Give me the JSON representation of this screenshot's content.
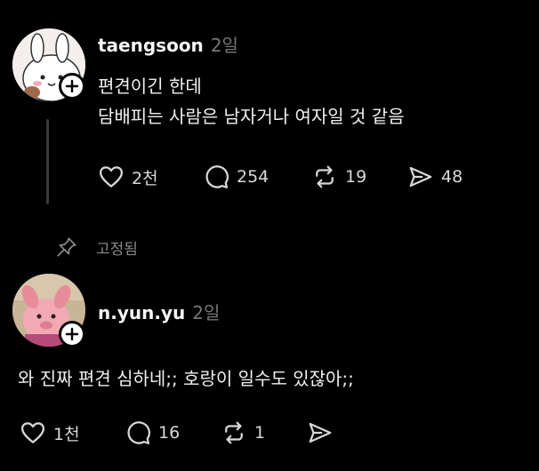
{
  "pinned_label": "고정됨",
  "posts": [
    {
      "username": "taengsoon",
      "time": "2일",
      "lines": [
        "편견이긴 한데",
        "담배피는 사람은 남자거나 여자일 것 같음"
      ],
      "likes": "2천",
      "comments": "254",
      "reposts": "19",
      "shares": "48"
    },
    {
      "username": "n.yun.yu",
      "time": "2일",
      "lines": [
        "와 진짜 편견 심하네;; 호랑이 일수도 있잖아;;"
      ],
      "likes": "1천",
      "comments": "16",
      "reposts": "1",
      "shares": ""
    }
  ],
  "colors": {
    "background": "#000000",
    "muted": "#777777",
    "text": "#f3f3f3"
  }
}
